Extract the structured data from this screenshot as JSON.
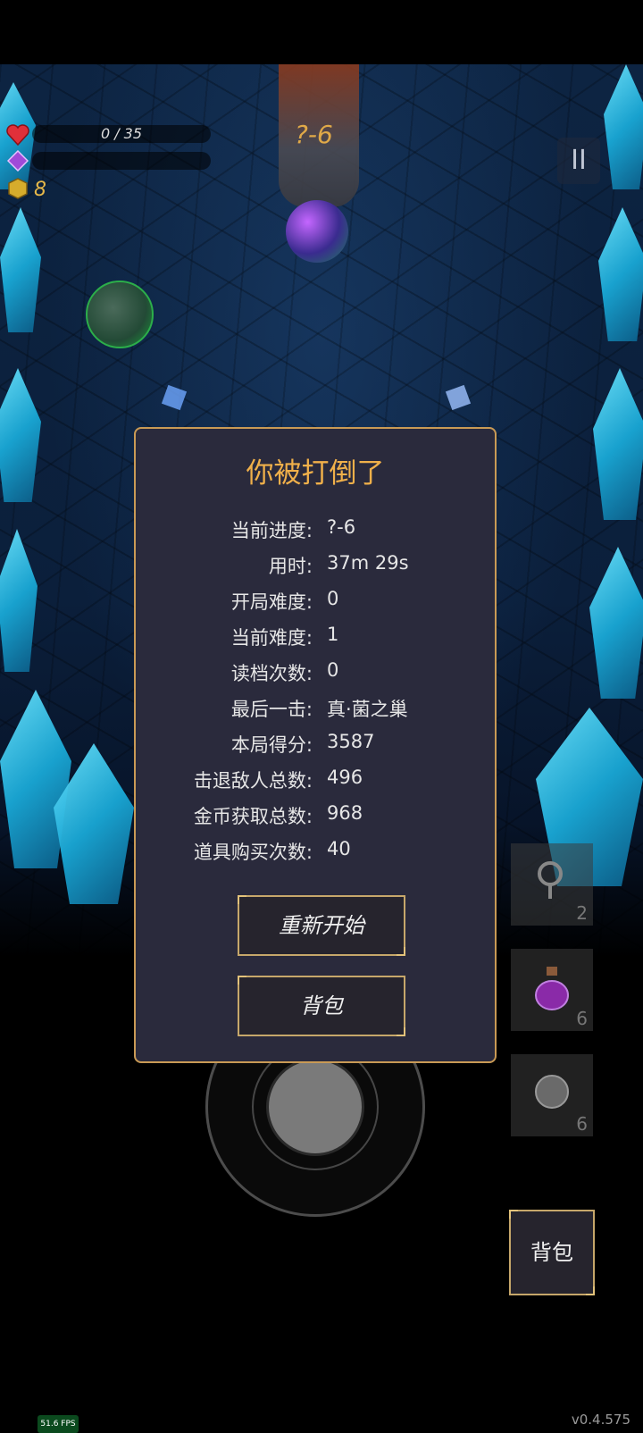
{
  "hud": {
    "hp_text": "0 / 35",
    "hp_fraction": 0,
    "gold": "8",
    "level": "?-6",
    "pause_symbol": "II"
  },
  "dialog": {
    "title": "你被打倒了",
    "stats": [
      {
        "label": "当前进度:",
        "value": "?-6"
      },
      {
        "label": "用时:",
        "value": "37m 29s"
      },
      {
        "label": "开局难度:",
        "value": "0"
      },
      {
        "label": "当前难度:",
        "value": "1"
      },
      {
        "label": "读档次数:",
        "value": "0"
      },
      {
        "label": "最后一击:",
        "value": "真·菌之巢"
      },
      {
        "label": "本局得分:",
        "value": "3587"
      },
      {
        "label": "击退敌人总数:",
        "value": "496"
      },
      {
        "label": "金币获取总数:",
        "value": "968"
      },
      {
        "label": "道具购买次数:",
        "value": "40"
      }
    ],
    "restart_label": "重新开始",
    "backpack_label": "背包"
  },
  "items": [
    {
      "icon": "key-icon",
      "count": "2"
    },
    {
      "icon": "potion-icon",
      "count": "6"
    },
    {
      "icon": "orb-icon",
      "count": "6"
    }
  ],
  "backpack_button": "背包",
  "version": "v0.4.575",
  "fps": "51.6 FPS",
  "colors": {
    "accent_gold": "#c99a55",
    "title": "#f0b04a",
    "dialog_bg": "#2a2a3c"
  }
}
